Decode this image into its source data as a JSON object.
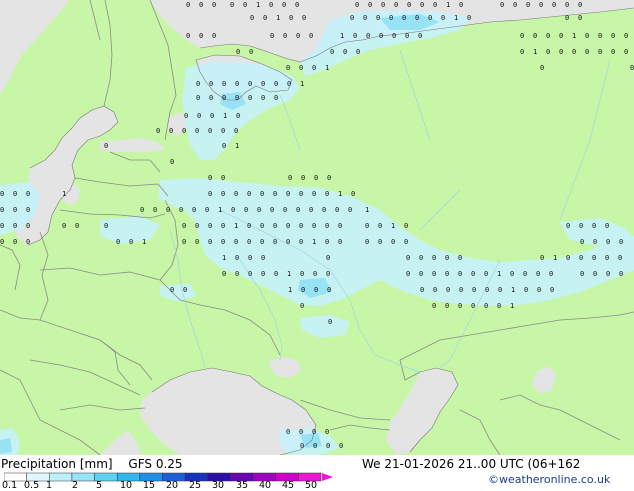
{
  "title": "Precipitation [mm]",
  "model": "GFS 0.25",
  "valid_time": "We 21-01-2026 21..00 UTC (06+162",
  "credit": "©weatheronline.co.uk",
  "legend": {
    "ticks": [
      "0.1",
      "0.5",
      "1",
      "2",
      "5",
      "10",
      "15",
      "20",
      "25",
      "30",
      "35",
      "40",
      "45",
      "50"
    ],
    "colors": [
      "#ffffff",
      "#dff8ff",
      "#bdf0ff",
      "#96e4fb",
      "#5fd0f5",
      "#32b6ee",
      "#1f8ee6",
      "#1a5fd6",
      "#1733bd",
      "#2a0fa8",
      "#6a06b0",
      "#9e03bf",
      "#cf02c9",
      "#ef16d2"
    ]
  },
  "map": {
    "land_color": "#c7f6a7",
    "sea_color": "#e4e4e4",
    "border_color": "#8a8a8a",
    "precip_light_color": "#c6f2fb",
    "precip_medium_color": "#8fdff6",
    "marker_symbol": "0",
    "marker_values": [
      "0",
      "1"
    ]
  }
}
